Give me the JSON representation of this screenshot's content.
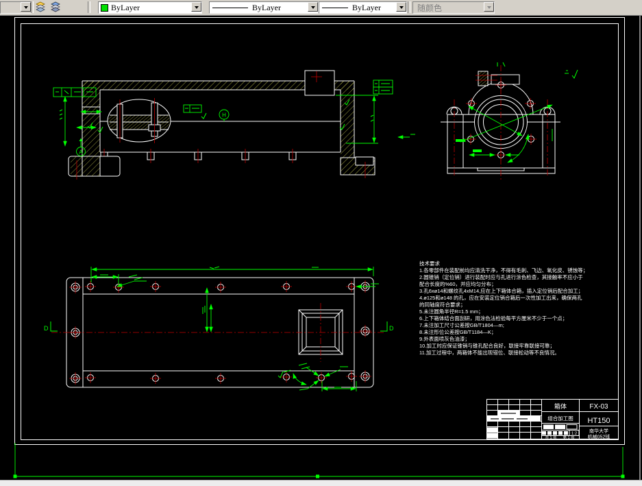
{
  "toolbar": {
    "color_control": {
      "value": "ByLayer",
      "swatch_color": "#00df00"
    },
    "linetype_control": {
      "value": "ByLayer"
    },
    "lineweight_control": {
      "value": "ByLayer"
    },
    "plotstyle_control": {
      "value": "随颜色",
      "enabled": false
    },
    "icons": {
      "dropdown_arrow": "▼",
      "layer_stack_yellow": "stacked-layers",
      "layer_stack_blue": "stacked-layers"
    }
  },
  "drawing": {
    "colors": {
      "outline": "#ffffff",
      "dimension": "#00ff00",
      "centerline": "#c00000",
      "hatch": "#e9e95e",
      "background": "#000000"
    },
    "labels": {
      "datum_a": "A",
      "balloon_h": "H",
      "section_d_left": "D",
      "section_d_right": "D"
    },
    "tech": {
      "title": "技术要求",
      "lines": [
        "1.各零部件在装配前均应清洗干净，不得有毛刺、飞边、氧化皮、锈蚀等；",
        "2.圆锥销（定位销）进行装配时应与孔进行涂色检查，其接触率不应小于",
        "配合长度的%60，并应均匀分布；",
        "3.孔6xø14和螺纹孔4xM14,应在上下箱体合箱，插入定位销后配合加工；",
        "4.ø125和ø148 的孔，应在安装定位销合箱后一次性加工出来，确保两孔",
        "的同轴度符合要求；",
        "5.未注圆角半径R=1.5 mm；",
        "6.上下箱体结合面刮研，用涂色法检验每平方厘米不少于一个点；",
        "7.未注加工尺寸公差按GB/T1804—m;",
        "8.未注形位公差按GB/T1184—K；",
        "9.外表面喷灰色油漆；",
        "10.加工时应保证锥销与锥孔配合良好，联接牢靠联接可靠；",
        "11.加工过程中，两箱体不能出现错位、联接松动等不良情况。"
      ]
    },
    "title_block": {
      "part_name": "箱体",
      "sheet_title": "组合加工图",
      "code": "FX-03",
      "material": "HT150",
      "org": "南华大学",
      "team": "机械052班",
      "scale": "1:2",
      "sheet_count": "共 1 张",
      "sheet_index": "第 1 张"
    }
  }
}
